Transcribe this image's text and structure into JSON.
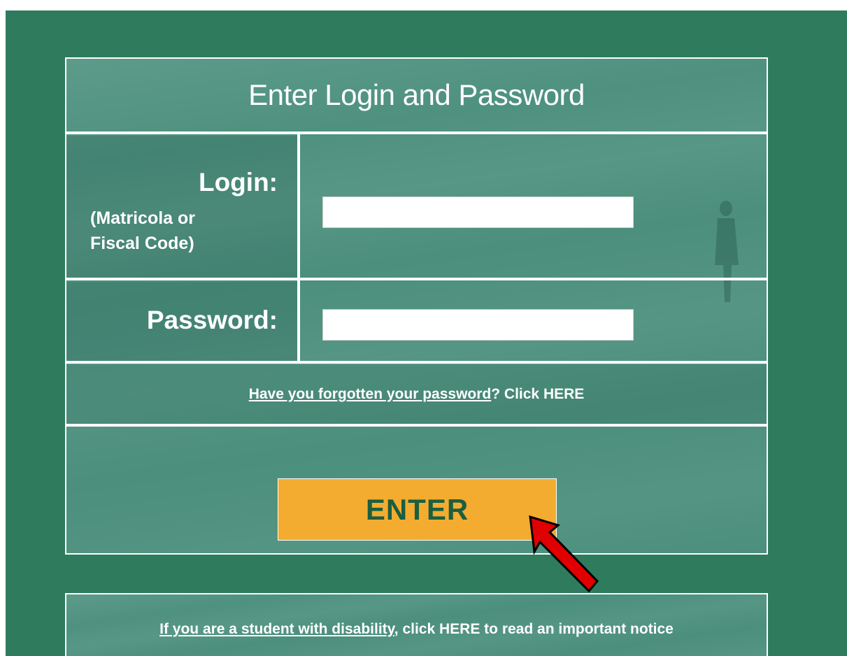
{
  "login_form": {
    "title": "Enter Login and Password",
    "login_label": "Login:",
    "login_hint": "(Matricola or Fiscal Code)",
    "login_value": "",
    "password_label": "Password:",
    "password_value": "",
    "forgot_link_text": "Have you forgotten your password",
    "forgot_suffix": "? Click HERE",
    "enter_button_label": "ENTER"
  },
  "notice": {
    "link_text": "If you are a student with disability",
    "suffix": ", click HERE to read an important notice"
  },
  "annotation": {
    "arrow_icon": "red-pointer-arrow-icon",
    "arrow_color": "#e10000"
  },
  "colors": {
    "page_background": "#2e7b5d",
    "panel_background": "#4b8f7c",
    "button_background": "#f3ac2f",
    "button_text": "#1b5e40"
  }
}
